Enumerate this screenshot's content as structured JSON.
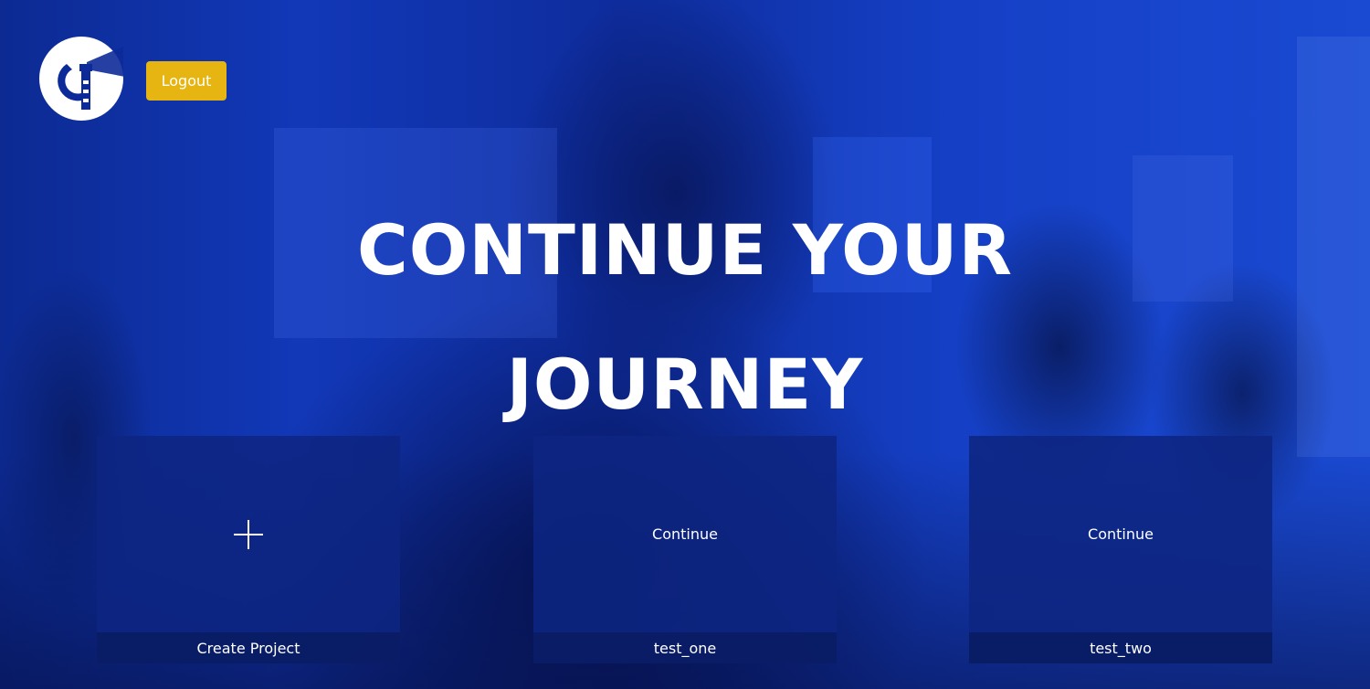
{
  "header": {
    "logo_icon": "lighthouse-logo-icon",
    "logout_label": "Logout"
  },
  "hero": {
    "title_line1": "CONTINUE YOUR",
    "title_line2": "JOURNEY"
  },
  "cards": [
    {
      "center_icon": "plus-icon",
      "center_label": "",
      "footer_label": "Create Project"
    },
    {
      "center_icon": "",
      "center_label": "Continue",
      "footer_label": "test_one"
    },
    {
      "center_icon": "",
      "center_label": "Continue",
      "footer_label": "test_two"
    }
  ],
  "colors": {
    "accent": "#e6b511",
    "background": "#0b2a9a",
    "card": "#0e2682",
    "text": "#ffffff"
  }
}
